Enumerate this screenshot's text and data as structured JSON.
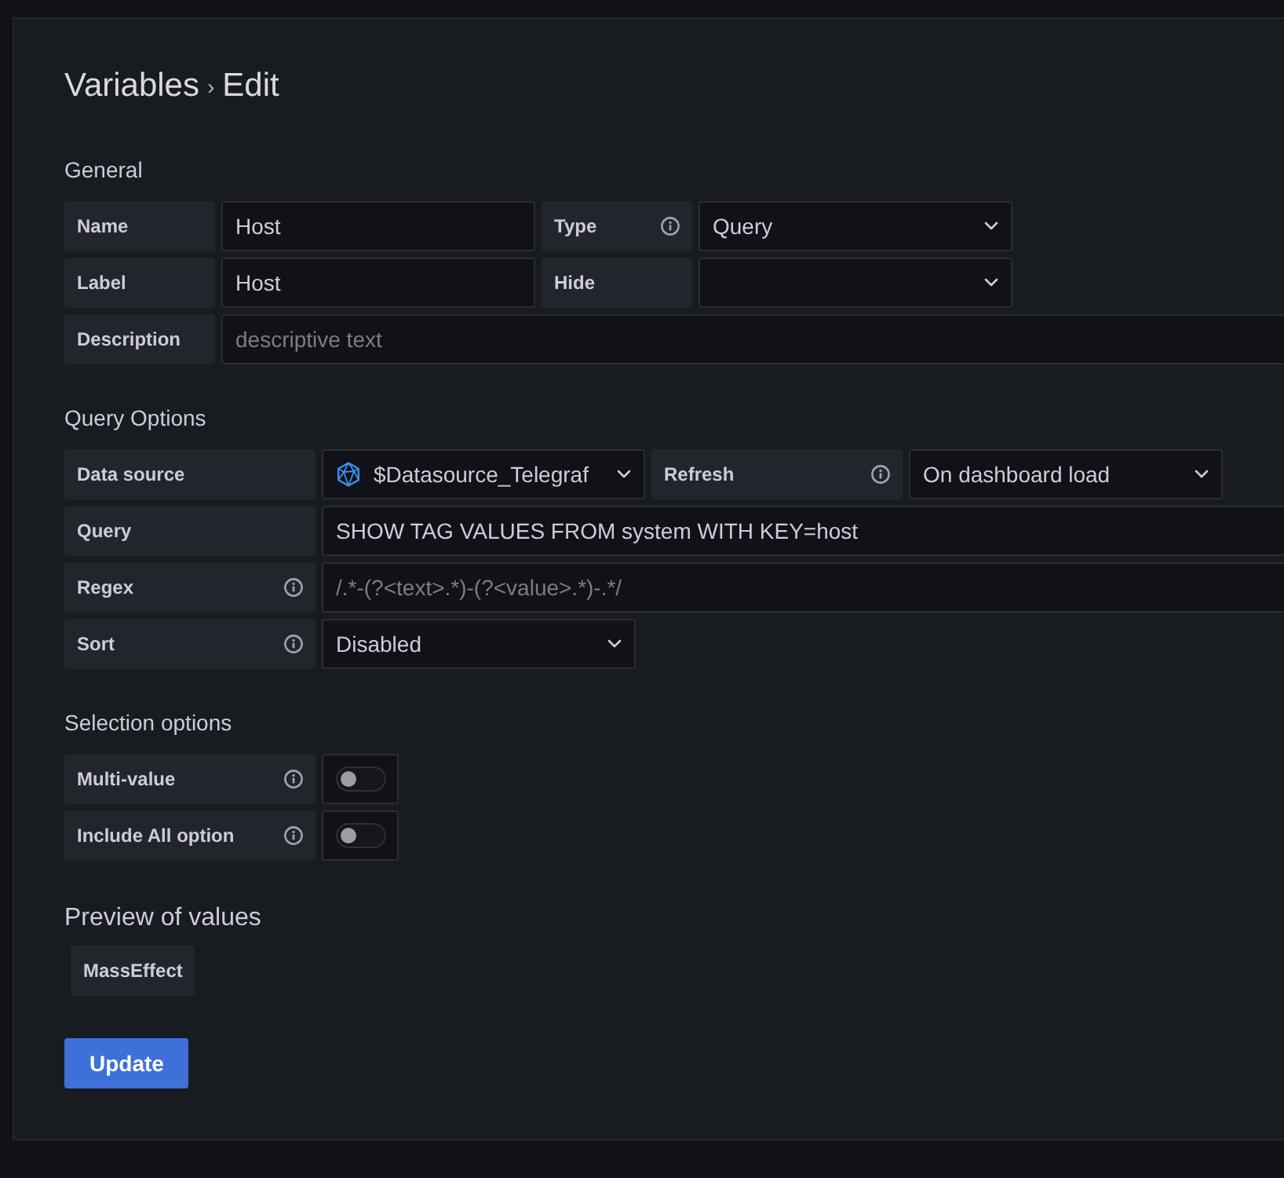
{
  "page_title": {
    "breadcrumb": [
      "Variables",
      "Edit"
    ],
    "separator": "›"
  },
  "sections": [
    {
      "title": "General",
      "rows": [
        [
          {
            "label": "Name",
            "info": false,
            "control": {
              "kind": "text",
              "value": "Host"
            }
          },
          {
            "label": "Type",
            "info": true,
            "control": {
              "kind": "select",
              "value": "Query"
            }
          }
        ],
        [
          {
            "label": "Label",
            "info": false,
            "control": {
              "kind": "text",
              "value": "Host"
            }
          },
          {
            "label": "Hide",
            "info": false,
            "control": {
              "kind": "select"
            }
          }
        ],
        [
          {
            "label": "Description",
            "info": false,
            "control": {
              "kind": "text",
              "placeholder": "descriptive text"
            }
          }
        ]
      ]
    },
    {
      "title": "Query Options",
      "rows": [
        [
          {
            "label": "Data source",
            "info": false,
            "control": {
              "kind": "datasource",
              "value": "$Datasource_Telegraf"
            }
          },
          {
            "label": "Refresh",
            "info": true,
            "control": {
              "kind": "select",
              "value": "On dashboard load"
            }
          }
        ],
        [
          {
            "label": "Query",
            "info": false,
            "control": {
              "kind": "text",
              "value": "SHOW TAG VALUES FROM system WITH KEY=host"
            }
          }
        ],
        [
          {
            "label": "Regex",
            "info": true,
            "control": {
              "kind": "text",
              "placeholder": "/.*-(?<text>.*)-(?<value>.*)-.*/"
            }
          }
        ],
        [
          {
            "label": "Sort",
            "info": true,
            "control": {
              "kind": "select",
              "value": "Disabled"
            }
          }
        ]
      ]
    },
    {
      "title": "Selection options",
      "rows": [
        [
          {
            "label": "Multi-value",
            "info": true,
            "control": {
              "kind": "switch",
              "on": false
            }
          }
        ],
        [
          {
            "label": "Include All option",
            "info": true,
            "control": {
              "kind": "switch",
              "on": false
            }
          }
        ]
      ]
    }
  ],
  "preview": {
    "title": "Preview of values",
    "values": [
      "MassEffect"
    ]
  },
  "update_button": {
    "label": "Update"
  }
}
